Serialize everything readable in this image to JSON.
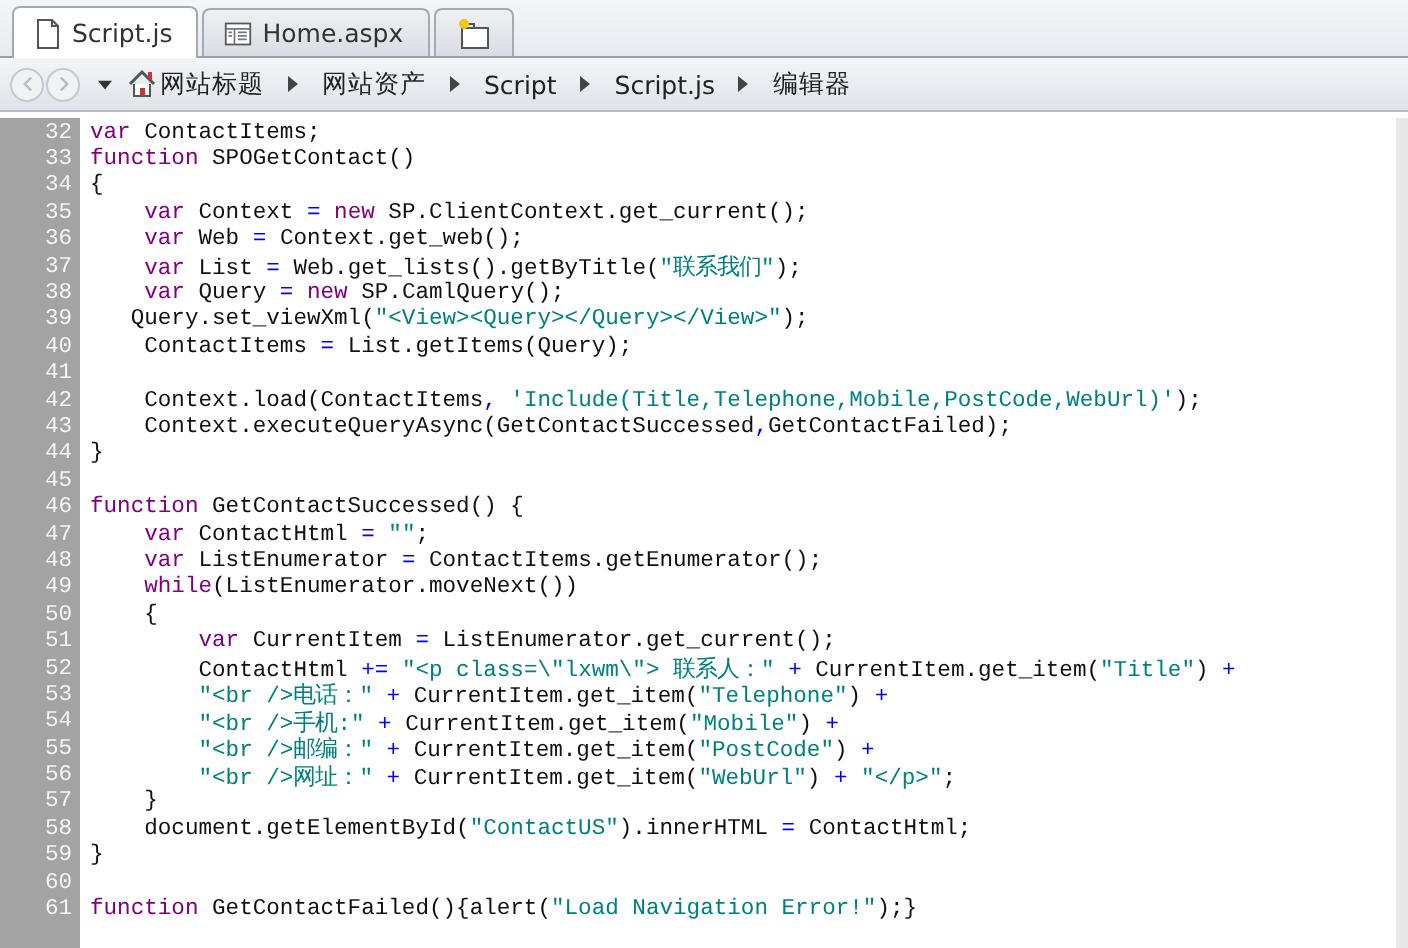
{
  "tabs": [
    {
      "label": "Script.js",
      "selected": true
    },
    {
      "label": "Home.aspx",
      "selected": false
    }
  ],
  "breadcrumb": [
    "网站标题",
    "网站资产",
    "Script",
    "Script.js",
    "编辑器"
  ],
  "lines": [
    {
      "number": "32",
      "tokens": [
        {
          "kind": "kw",
          "text": "var"
        },
        {
          "kind": "plain",
          "text": " ContactItems;"
        }
      ]
    },
    {
      "number": "33",
      "tokens": [
        {
          "kind": "kw",
          "text": "function"
        },
        {
          "kind": "plain",
          "text": " SPOGetContact()"
        }
      ]
    },
    {
      "number": "34",
      "tokens": [
        {
          "kind": "plain",
          "text": "{"
        }
      ]
    },
    {
      "number": "35",
      "tokens": [
        {
          "kind": "kw",
          "text": "    var"
        },
        {
          "kind": "plain",
          "text": " Context"
        },
        {
          "kind": "op",
          "text": " = "
        },
        {
          "kind": "kw",
          "text": "new"
        },
        {
          "kind": "plain",
          "text": " SP.ClientContext.get_current();"
        }
      ]
    },
    {
      "number": "36",
      "tokens": [
        {
          "kind": "kw",
          "text": "    var"
        },
        {
          "kind": "plain",
          "text": " Web"
        },
        {
          "kind": "op",
          "text": " = "
        },
        {
          "kind": "plain",
          "text": "Context.get_web();"
        }
      ]
    },
    {
      "number": "37",
      "tokens": [
        {
          "kind": "kw",
          "text": "    var"
        },
        {
          "kind": "plain",
          "text": " List"
        },
        {
          "kind": "op",
          "text": " = "
        },
        {
          "kind": "plain",
          "text": "Web.get_lists().getByTitle("
        },
        {
          "kind": "str",
          "text": "\"联系我们\""
        },
        {
          "kind": "plain",
          "text": ");"
        }
      ]
    },
    {
      "number": "38",
      "tokens": [
        {
          "kind": "kw",
          "text": "    var"
        },
        {
          "kind": "plain",
          "text": " Query"
        },
        {
          "kind": "op",
          "text": " = "
        },
        {
          "kind": "kw",
          "text": "new"
        },
        {
          "kind": "plain",
          "text": " SP.CamlQuery();"
        }
      ]
    },
    {
      "number": "39",
      "tokens": [
        {
          "kind": "plain",
          "text": "   Query.set_viewXml("
        },
        {
          "kind": "str",
          "text": "\"<View><Query></Query></View>\""
        },
        {
          "kind": "plain",
          "text": ");"
        }
      ]
    },
    {
      "number": "40",
      "tokens": [
        {
          "kind": "plain",
          "text": "    ContactItems"
        },
        {
          "kind": "op",
          "text": " = "
        },
        {
          "kind": "plain",
          "text": "List.getItems(Query);"
        }
      ]
    },
    {
      "number": "41"
    },
    {
      "number": "42",
      "tokens": [
        {
          "kind": "plain",
          "text": "    Context.load(ContactItems"
        },
        {
          "kind": "op",
          "text": ", "
        },
        {
          "kind": "str",
          "text": "'Include(Title,Telephone,Mobile,PostCode,WebUrl)'"
        },
        {
          "kind": "plain",
          "text": ");"
        }
      ]
    },
    {
      "number": "43",
      "tokens": [
        {
          "kind": "plain",
          "text": "    Context.executeQueryAsync(GetContactSuccessed"
        },
        {
          "kind": "op",
          "text": ","
        },
        {
          "kind": "plain",
          "text": "GetContactFailed);"
        }
      ]
    },
    {
      "number": "44",
      "tokens": [
        {
          "kind": "plain",
          "text": "}"
        }
      ]
    },
    {
      "number": "45"
    },
    {
      "number": "46",
      "tokens": [
        {
          "kind": "kw",
          "text": "function"
        },
        {
          "kind": "plain",
          "text": " GetContactSuccessed() {"
        }
      ]
    },
    {
      "number": "47",
      "tokens": [
        {
          "kind": "kw",
          "text": "    var"
        },
        {
          "kind": "plain",
          "text": " ContactHtml"
        },
        {
          "kind": "op",
          "text": " = "
        },
        {
          "kind": "str",
          "text": "\"\""
        },
        {
          "kind": "plain",
          "text": ";"
        }
      ]
    },
    {
      "number": "48",
      "tokens": [
        {
          "kind": "kw",
          "text": "    var"
        },
        {
          "kind": "plain",
          "text": " ListEnumerator"
        },
        {
          "kind": "op",
          "text": " = "
        },
        {
          "kind": "plain",
          "text": "ContactItems.getEnumerator();"
        }
      ]
    },
    {
      "number": "49",
      "tokens": [
        {
          "kind": "kw",
          "text": "    while"
        },
        {
          "kind": "plain",
          "text": "(ListEnumerator.moveNext())"
        }
      ]
    },
    {
      "number": "50",
      "tokens": [
        {
          "kind": "plain",
          "text": "    {"
        }
      ]
    },
    {
      "number": "51",
      "tokens": [
        {
          "kind": "kw",
          "text": "        var"
        },
        {
          "kind": "plain",
          "text": " CurrentItem"
        },
        {
          "kind": "op",
          "text": " = "
        },
        {
          "kind": "plain",
          "text": "ListEnumerator.get_current();"
        }
      ]
    },
    {
      "number": "52",
      "tokens": [
        {
          "kind": "plain",
          "text": "        ContactHtml"
        },
        {
          "kind": "op",
          "text": " += "
        },
        {
          "kind": "str",
          "text": "\"<p class=\\\"lxwm\\\"> 联系人：\""
        },
        {
          "kind": "op",
          "text": " + "
        },
        {
          "kind": "plain",
          "text": "CurrentItem.get_item("
        },
        {
          "kind": "str",
          "text": "\"Title\""
        },
        {
          "kind": "plain",
          "text": ")"
        },
        {
          "kind": "op",
          "text": " +"
        }
      ]
    },
    {
      "number": "53",
      "tokens": [
        {
          "kind": "str",
          "text": "        \"<br />电话：\""
        },
        {
          "kind": "op",
          "text": " + "
        },
        {
          "kind": "plain",
          "text": "CurrentItem.get_item("
        },
        {
          "kind": "str",
          "text": "\"Telephone\""
        },
        {
          "kind": "plain",
          "text": ")"
        },
        {
          "kind": "op",
          "text": " +"
        }
      ]
    },
    {
      "number": "54",
      "tokens": [
        {
          "kind": "str",
          "text": "        \"<br />手机:\""
        },
        {
          "kind": "op",
          "text": " + "
        },
        {
          "kind": "plain",
          "text": "CurrentItem.get_item("
        },
        {
          "kind": "str",
          "text": "\"Mobile\""
        },
        {
          "kind": "plain",
          "text": ")"
        },
        {
          "kind": "op",
          "text": " +"
        }
      ]
    },
    {
      "number": "55",
      "tokens": [
        {
          "kind": "str",
          "text": "        \"<br />邮编：\""
        },
        {
          "kind": "op",
          "text": " + "
        },
        {
          "kind": "plain",
          "text": "CurrentItem.get_item("
        },
        {
          "kind": "str",
          "text": "\"PostCode\""
        },
        {
          "kind": "plain",
          "text": ")"
        },
        {
          "kind": "op",
          "text": " +"
        }
      ]
    },
    {
      "number": "56",
      "tokens": [
        {
          "kind": "str",
          "text": "        \"<br />网址：\""
        },
        {
          "kind": "op",
          "text": " + "
        },
        {
          "kind": "plain",
          "text": "CurrentItem.get_item("
        },
        {
          "kind": "str",
          "text": "\"WebUrl\""
        },
        {
          "kind": "plain",
          "text": ")"
        },
        {
          "kind": "op",
          "text": " + "
        },
        {
          "kind": "str",
          "text": "\"</p>\""
        },
        {
          "kind": "plain",
          "text": ";"
        }
      ]
    },
    {
      "number": "57",
      "tokens": [
        {
          "kind": "plain",
          "text": "    }"
        }
      ]
    },
    {
      "number": "58",
      "tokens": [
        {
          "kind": "plain",
          "text": "    document.getElementById("
        },
        {
          "kind": "str",
          "text": "\"ContactUS\""
        },
        {
          "kind": "plain",
          "text": ").innerHTML"
        },
        {
          "kind": "op",
          "text": " = "
        },
        {
          "kind": "plain",
          "text": "ContactHtml;"
        }
      ]
    },
    {
      "number": "59",
      "tokens": [
        {
          "kind": "plain",
          "text": "}"
        }
      ]
    },
    {
      "number": "60"
    },
    {
      "number": "61",
      "tokens": [
        {
          "kind": "kw",
          "text": "function"
        },
        {
          "kind": "plain",
          "text": " GetContactFailed(){alert("
        },
        {
          "kind": "str",
          "text": "\"Load Navigation Error!\""
        },
        {
          "kind": "plain",
          "text": ");}"
        }
      ]
    }
  ]
}
